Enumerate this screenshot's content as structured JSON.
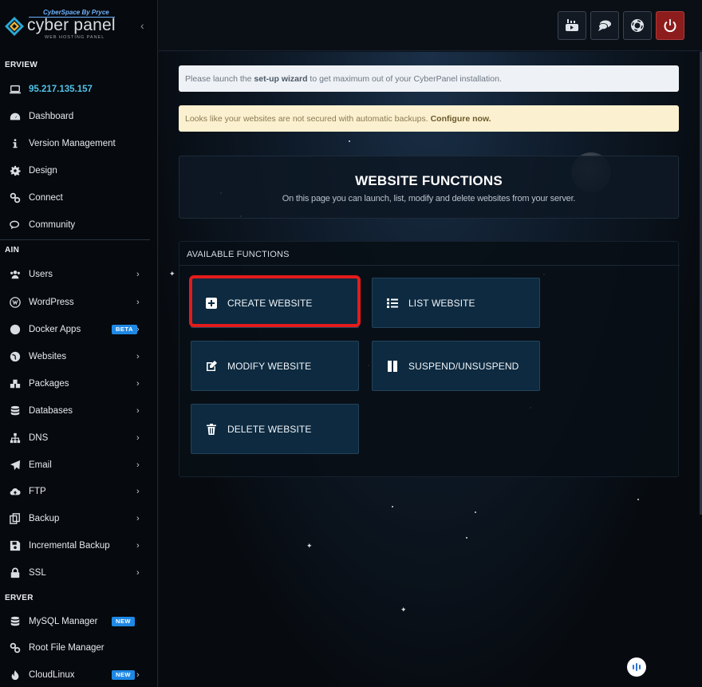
{
  "brand": {
    "tagline": "CyberSpace By Pryce",
    "name": "cyber panel",
    "subtitle": "WEB HOSTING PANEL"
  },
  "sidebar": {
    "sections": [
      "ERVIEW",
      "AIN",
      "ERVER"
    ],
    "overview_items": [
      {
        "label": "95.217.135.157",
        "icon": "laptop-icon"
      },
      {
        "label": "Dashboard",
        "icon": "dashboard-icon"
      },
      {
        "label": "Version Management",
        "icon": "info-icon"
      },
      {
        "label": "Design",
        "icon": "gear-icon"
      },
      {
        "label": "Connect",
        "icon": "link-icon"
      },
      {
        "label": "Community",
        "icon": "comments-icon"
      }
    ],
    "main_items": [
      {
        "label": "Users",
        "icon": "users-icon"
      },
      {
        "label": "WordPress",
        "icon": "wordpress-icon"
      },
      {
        "label": "Docker Apps",
        "icon": "docker-icon",
        "badge": "BETA"
      },
      {
        "label": "Websites",
        "icon": "globe-icon"
      },
      {
        "label": "Packages",
        "icon": "packages-icon"
      },
      {
        "label": "Databases",
        "icon": "database-icon"
      },
      {
        "label": "DNS",
        "icon": "sitemap-icon"
      },
      {
        "label": "Email",
        "icon": "paper-plane-icon"
      },
      {
        "label": "FTP",
        "icon": "cloud-upload-icon"
      },
      {
        "label": "Backup",
        "icon": "copy-icon"
      },
      {
        "label": "Incremental Backup",
        "icon": "save-icon"
      },
      {
        "label": "SSL",
        "icon": "lock-icon"
      }
    ],
    "server_items": [
      {
        "label": "MySQL Manager",
        "icon": "database-icon",
        "badge": "NEW"
      },
      {
        "label": "Root File Manager",
        "icon": "link-icon"
      },
      {
        "label": "CloudLinux",
        "icon": "fire-icon",
        "badge": "NEW"
      }
    ]
  },
  "topbar": {
    "buttons": [
      "youtube-icon",
      "chat-icon",
      "lifebuoy-icon",
      "power-icon"
    ],
    "power_color": "#8d1c1c"
  },
  "alerts": {
    "setup_prefix": "Please launch the ",
    "setup_link": "set-up wizard",
    "setup_suffix": " to get maximum out of your CyberPanel installation.",
    "backup_prefix": "Looks like your websites are not secured with automatic backups. ",
    "backup_link": "Configure now."
  },
  "page": {
    "title": "WEBSITE FUNCTIONS",
    "subtitle": "On this page you can launch, list, modify and delete websites from your server."
  },
  "functions": {
    "title": "AVAILABLE FUNCTIONS",
    "buttons": [
      {
        "label": "CREATE WEBSITE",
        "icon": "plus-square-icon"
      },
      {
        "label": "LIST WEBSITE",
        "icon": "list-icon"
      },
      {
        "label": "MODIFY WEBSITE",
        "icon": "edit-icon"
      },
      {
        "label": "SUSPEND/UNSUSPEND",
        "icon": "pause-icon"
      },
      {
        "label": "DELETE WEBSITE",
        "icon": "trash-icon"
      }
    ],
    "highlight_color": "#e41b1b"
  },
  "colors": {
    "accent": "#4fc3e9",
    "badge": "#1e88e5",
    "button_bg": "#0d2a40"
  }
}
